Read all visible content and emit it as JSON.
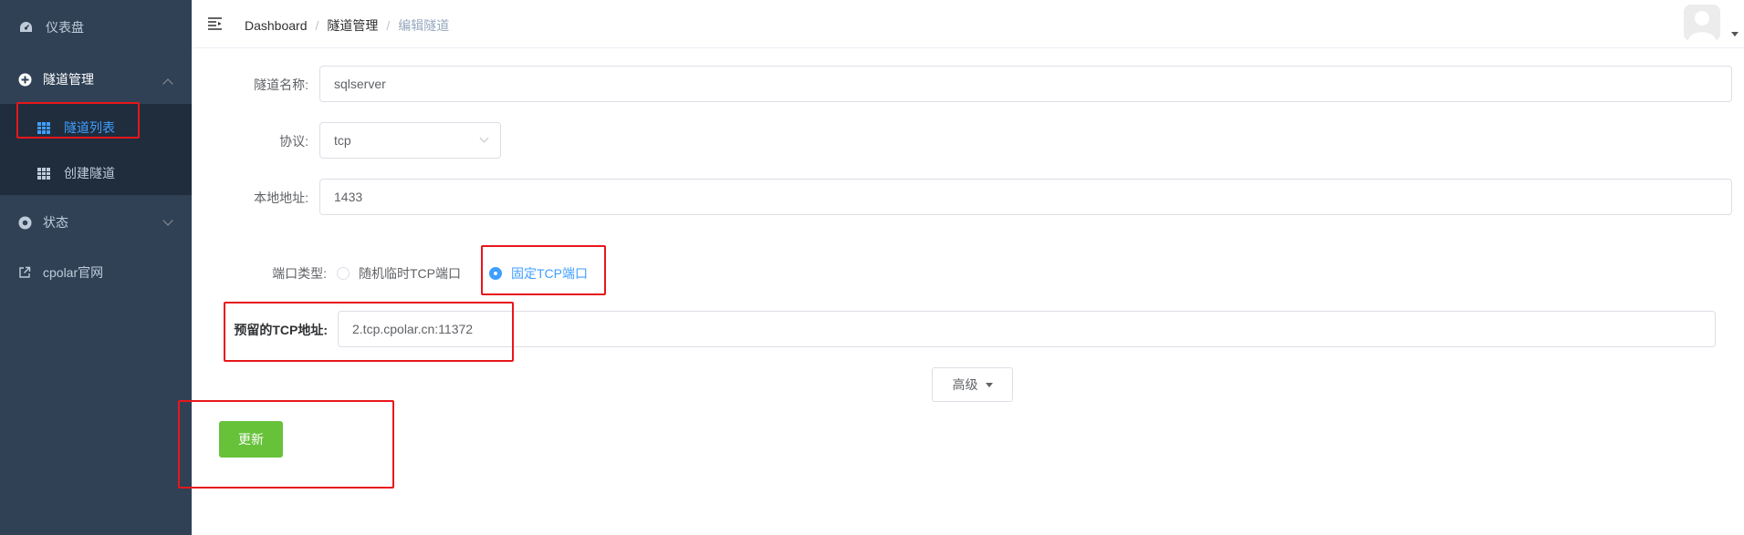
{
  "sidebar": {
    "items": [
      {
        "label": "仪表盘",
        "icon": "dashboard-icon"
      },
      {
        "label": "隧道管理",
        "icon": "tunnel-management-icon"
      },
      {
        "label": "隧道列表",
        "icon": "grid-icon"
      },
      {
        "label": "创建隧道",
        "icon": "grid-icon"
      },
      {
        "label": "状态",
        "icon": "status-icon"
      },
      {
        "label": "cpolar官网",
        "icon": "external-link-icon"
      }
    ],
    "active_color": "#409eff"
  },
  "breadcrumb": [
    "Dashboard",
    "隧道管理",
    "编辑隧道"
  ],
  "form": {
    "name_label": "隧道名称:",
    "name_value": "sqlserver",
    "protocol_label": "协议:",
    "protocol_value": "tcp",
    "local_label": "本地地址:",
    "local_value": "1433",
    "port_type_label": "端口类型:",
    "port_type_options": [
      "随机临时TCP端口",
      "固定TCP端口"
    ],
    "port_type_selected": "固定TCP端口",
    "reserved_label": "预留的TCP地址:",
    "reserved_value": "2.tcp.cpolar.cn:11372",
    "advanced_label": "高级",
    "update_label": "更新"
  },
  "colors": {
    "sidebar_bg": "#304156",
    "submenu_bg": "#1f2d3d",
    "primary": "#409eff",
    "success": "#67c23a",
    "annotation_red": "#e8161b"
  }
}
